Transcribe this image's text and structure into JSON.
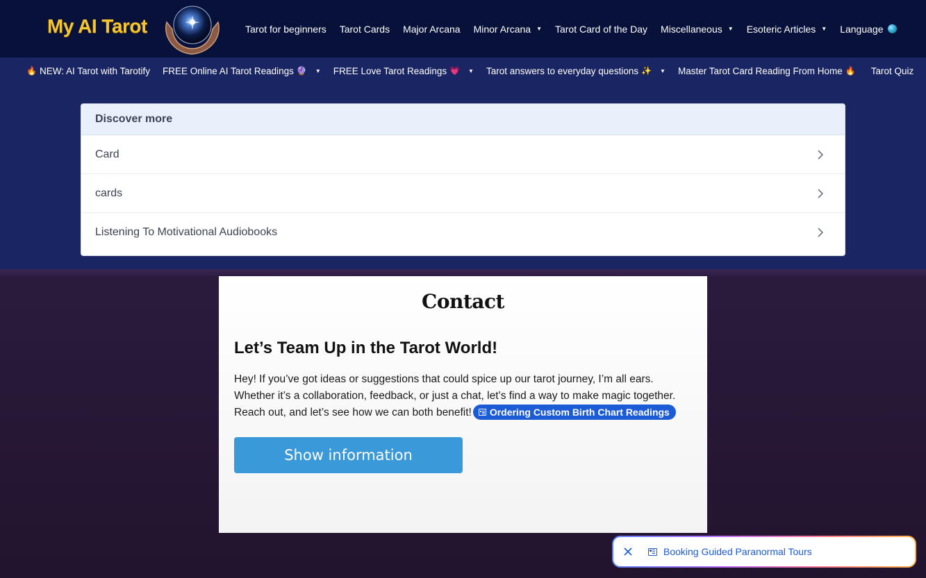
{
  "header": {
    "logo_text": "My AI Tarot",
    "nav": [
      {
        "label": "Tarot for beginners",
        "dropdown": false
      },
      {
        "label": "Tarot Cards",
        "dropdown": false
      },
      {
        "label": "Major Arcana",
        "dropdown": false
      },
      {
        "label": "Minor Arcana",
        "dropdown": true
      },
      {
        "label": "Tarot Card of the Day",
        "dropdown": false
      },
      {
        "label": "Miscellaneous",
        "dropdown": true
      },
      {
        "label": "Esoteric Articles",
        "dropdown": true
      },
      {
        "label": "Language",
        "dropdown": false
      }
    ]
  },
  "subnav": [
    {
      "prefix_emoji": "🔥",
      "label": "NEW: AI Tarot with Tarotify",
      "suffix_emoji": "",
      "dropdown": false
    },
    {
      "prefix_emoji": "",
      "label": "FREE Online AI Tarot Readings",
      "suffix_emoji": "🔮",
      "dropdown": true
    },
    {
      "prefix_emoji": "",
      "label": "FREE Love Tarot Readings",
      "suffix_emoji": "💗",
      "dropdown": true
    },
    {
      "prefix_emoji": "",
      "label": "Tarot answers to everyday questions",
      "suffix_emoji": "✨",
      "dropdown": true
    },
    {
      "prefix_emoji": "",
      "label": "Master Tarot Card Reading From Home",
      "suffix_emoji": "🔥",
      "dropdown": false
    },
    {
      "prefix_emoji": "",
      "label": "Tarot Quiz",
      "suffix_emoji": "",
      "dropdown": false
    }
  ],
  "discover": {
    "title": "Discover more",
    "items": [
      "Card",
      "cards",
      "Listening To Motivational Audiobooks"
    ]
  },
  "contact": {
    "title": "Contact",
    "heading": "Let’s Team Up in the Tarot World!",
    "paragraph": "Hey! If you’ve got ideas or suggestions that could spice up our tarot journey, I’m all ears. Whether it’s a collaboration, feedback, or just a chat, let’s find a way to make magic together. Reach out, and let’s see how we can both benefit!",
    "pill_label": "Ordering Custom Birth Chart Readings",
    "button_label": "Show information"
  },
  "floater": {
    "label": "Booking Guided Paranormal Tours"
  },
  "colors": {
    "topbar": "#07113a",
    "subnav": "#1a2664",
    "logo": "#f7c62f",
    "link_blue": "#1c5bd6",
    "button": "#3a9ad9"
  }
}
